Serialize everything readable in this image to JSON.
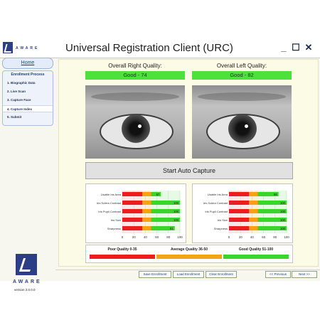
{
  "app": {
    "logo_text": "AWARE",
    "title": "Universal Registration Client (URC)",
    "window_buttons": {
      "minimize": "_",
      "maximize": "☐",
      "close": "✕"
    }
  },
  "sidebar": {
    "home": "Home",
    "panel_title": "Enrollment Process",
    "steps": [
      {
        "label": "1. Biographic Data"
      },
      {
        "label": "2. Live Scan"
      },
      {
        "label": "3. Capture Face"
      },
      {
        "label": "4. Capture Index"
      },
      {
        "label": "5. Submit"
      }
    ],
    "active_step_index": 3,
    "brand": "AWARE",
    "version": "version 2.0.0.0"
  },
  "quality": {
    "right": {
      "label": "Overall Right Quality:",
      "value": "Good - 74"
    },
    "left": {
      "label": "Overall Left Quality:",
      "value": "Good - 82"
    }
  },
  "start_button": "Start Auto Capture",
  "chart_data": [
    {
      "type": "bar",
      "categories": [
        "Usable Iris Area",
        "Iris Sclera Contrast",
        "Iris Pupil Contrast",
        "Iris Size",
        "Sharpness"
      ],
      "values": [
        67,
        100,
        100,
        100,
        91
      ],
      "value_labels": [
        "67",
        "100",
        "100",
        "100",
        "91"
      ],
      "xlim": [
        0,
        100
      ],
      "xticks": [
        "0",
        "20",
        "40",
        "60",
        "80",
        "100"
      ]
    },
    {
      "type": "bar",
      "categories": [
        "Usable Iris Area",
        "Iris Sclera Contrast",
        "Iris Pupil Contrast",
        "Iris Size",
        "Sharpness"
      ],
      "values": [
        86,
        100,
        100,
        100,
        100
      ],
      "value_labels": [
        "86",
        "100",
        "100",
        "100",
        "100"
      ],
      "xlim": [
        0,
        100
      ],
      "xticks": [
        "0",
        "20",
        "40",
        "60",
        "80",
        "100"
      ]
    }
  ],
  "legend": [
    {
      "label": "Poor Quality 0-35",
      "color": "#ee1c1c"
    },
    {
      "label": "Average Quality 36-50",
      "color": "#f5a313"
    },
    {
      "label": "Good Quality 51-100",
      "color": "#38d52b"
    }
  ],
  "bottom_buttons": {
    "save": "Save Enrollment",
    "load": "Load Enrollment",
    "clear": "Clear Enrollment",
    "previous": "<< Previous",
    "next": "Next >>"
  },
  "colors": {
    "poor": "#ee1c1c",
    "average": "#f5a313",
    "good": "#38d52b",
    "accent": "#2c3f86"
  }
}
